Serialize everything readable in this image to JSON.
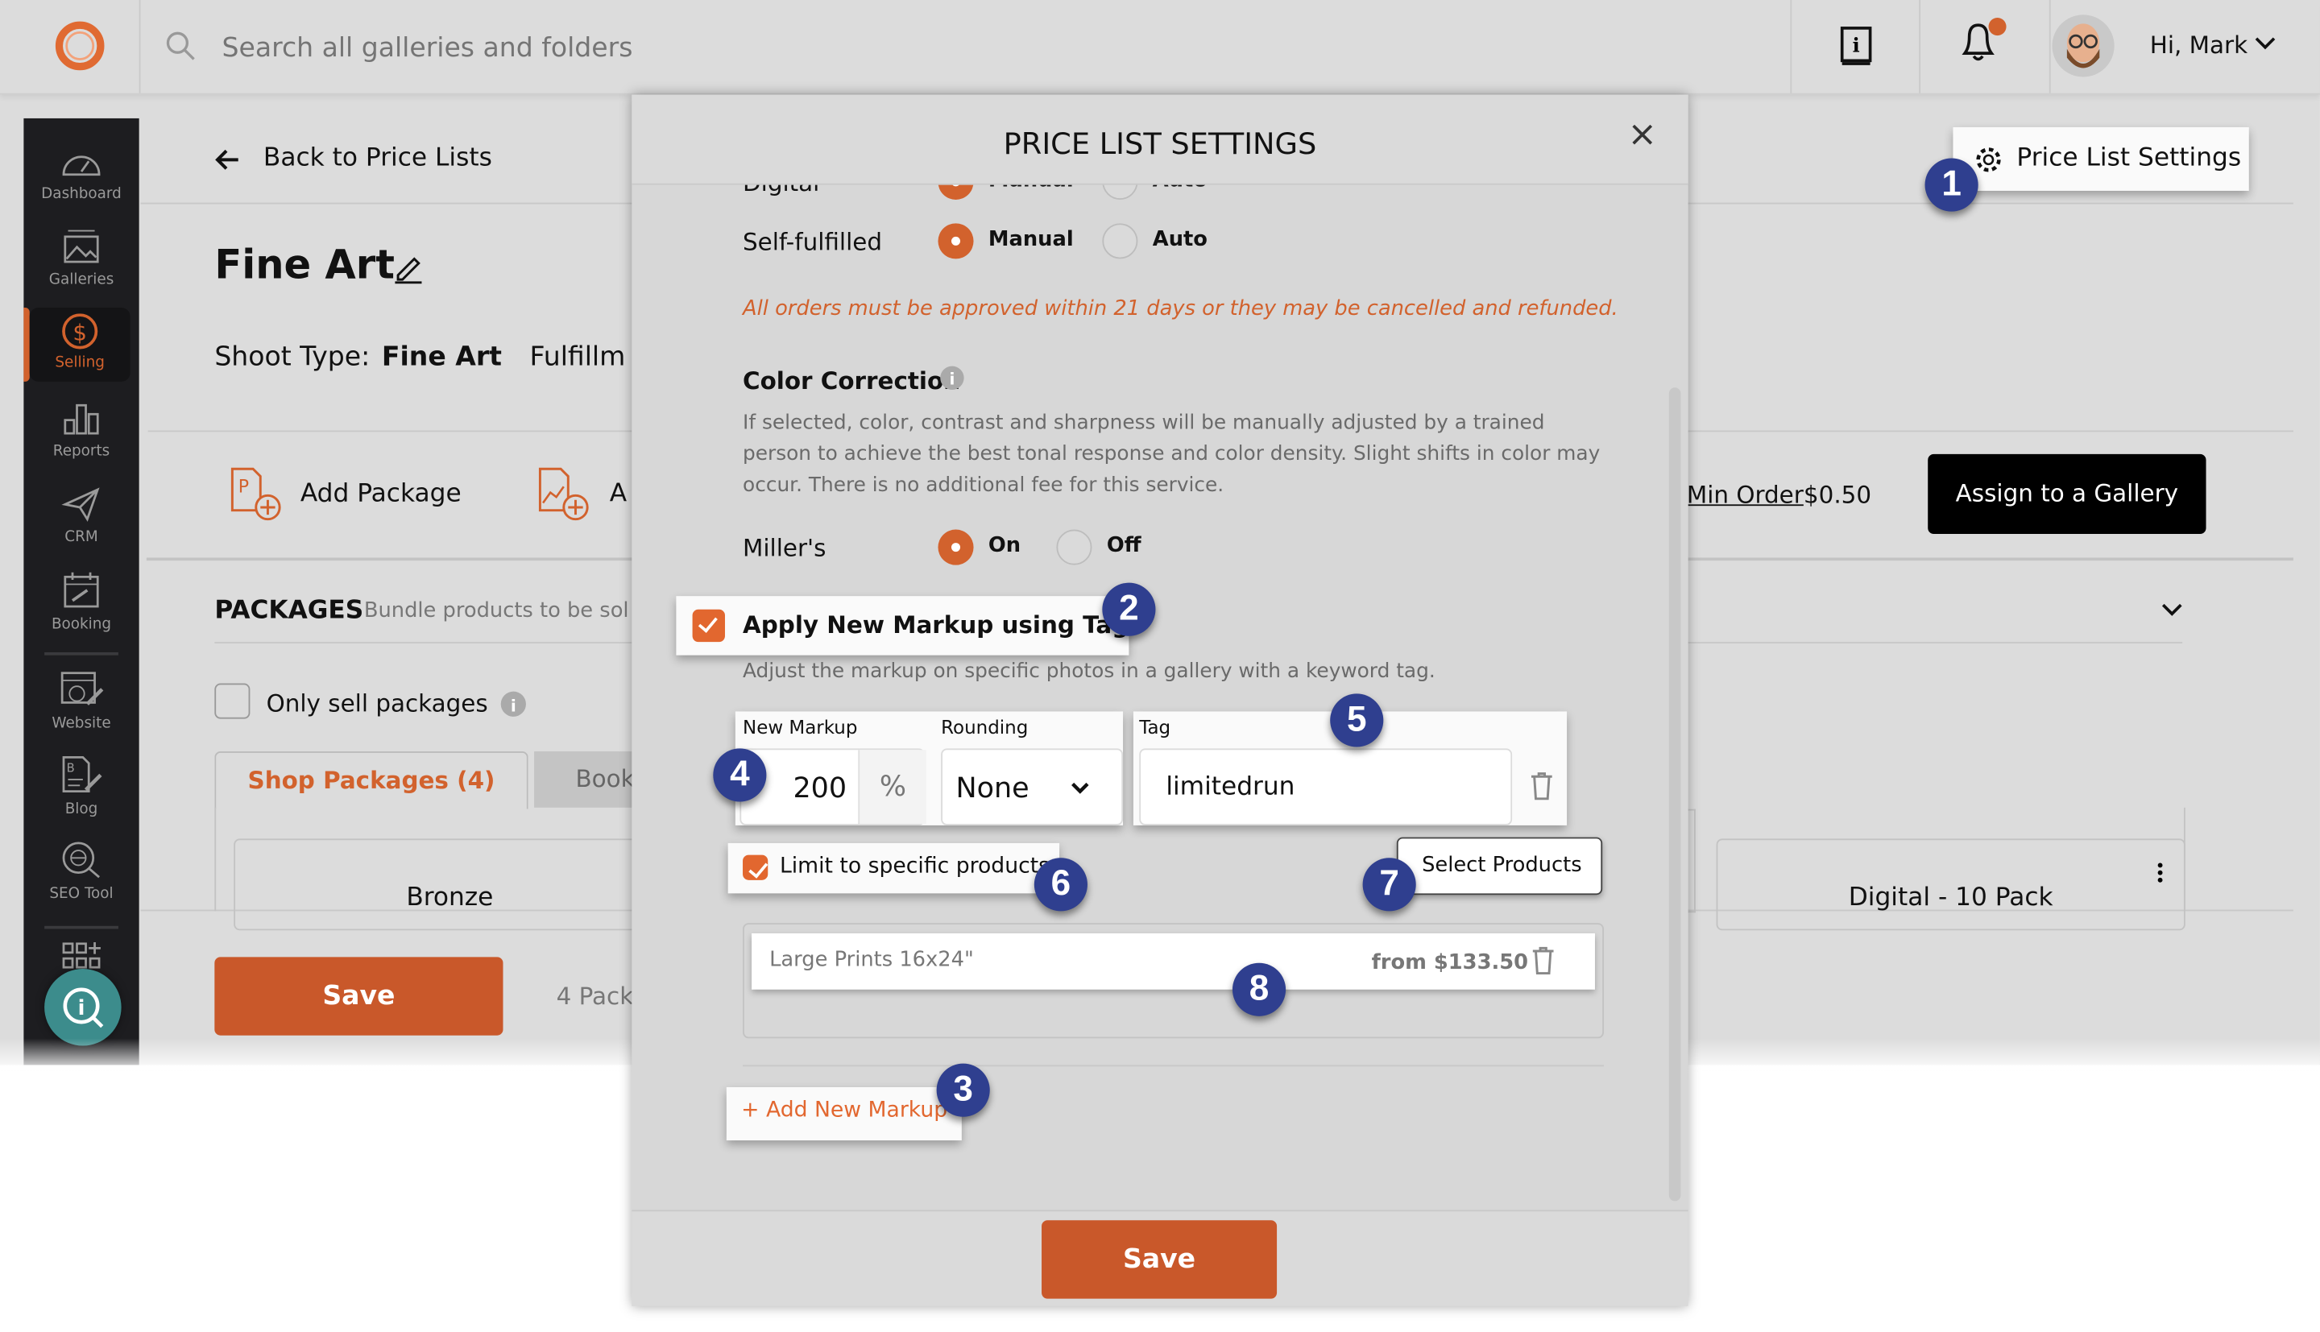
{
  "topbar": {
    "search_placeholder": "Search all galleries and folders",
    "greeting": "Hi, Mark",
    "notification_dot_color": "#d2622d",
    "icons": [
      "logo-icon",
      "search-icon",
      "help-book-icon",
      "bell-icon",
      "avatar",
      "chevron-down-icon"
    ]
  },
  "sidebar": {
    "items": [
      {
        "label": "Dashboard",
        "icon": "dashboard-gauge-icon"
      },
      {
        "label": "Galleries",
        "icon": "galleries-image-icon"
      },
      {
        "label": "Selling",
        "icon": "dollar-icon",
        "active": true
      },
      {
        "label": "Reports",
        "icon": "bar-chart-icon"
      },
      {
        "label": "CRM",
        "icon": "paper-plane-icon"
      },
      {
        "label": "Booking",
        "icon": "calendar-icon"
      },
      {
        "label": "Website",
        "icon": "website-edit-icon"
      },
      {
        "label": "Blog",
        "icon": "blog-edit-icon"
      },
      {
        "label": "SEO Tool",
        "icon": "seo-globe-icon"
      }
    ],
    "apps_icon": "add-apps-icon",
    "help_icon": "help-search-icon"
  },
  "main": {
    "back_label": "Back to Price Lists",
    "title": "Fine Art",
    "shoot_type_label": "Shoot Type:",
    "shoot_type_value": "Fine Art",
    "fulfillment_label": "Fulfillm",
    "add_package_label": "Add Package",
    "add_second_label": "A",
    "min_order_label": "Min Order",
    "min_order_value": "$0.50",
    "assign_button": "Assign to a Gallery",
    "price_list_settings_button": "Price List Settings",
    "packages_heading": "PACKAGES",
    "packages_subtitle": "Bundle products to be sol",
    "only_sell_packages": "Only sell packages",
    "tabs": [
      {
        "label": "Shop Packages (4)",
        "active": true
      },
      {
        "label": "Book"
      }
    ],
    "cards": [
      "Bronze",
      "Digital - 10 Pack"
    ],
    "save_button": "Save",
    "pack_count": "4 Pack",
    "accent_color": "#d2622d"
  },
  "modal": {
    "title": "PRICE LIST SETTINGS",
    "digital_row": {
      "label": "Digital",
      "manual": "Manual",
      "auto": "Auto",
      "selected": "Manual"
    },
    "self_fulfilled_row": {
      "label": "Self-fulfilled",
      "manual": "Manual",
      "auto": "Auto",
      "selected": "Manual"
    },
    "warning": "All orders must be approved within 21 days or they may be cancelled and refunded.",
    "color_correction": {
      "heading": "Color Correction",
      "description_lines": [
        "If selected, color, contrast and sharpness will be manually adjusted by a trained",
        "person to achieve the best tonal response and color density. Slight shifts in color may",
        "occur. There is no additional fee for this service."
      ]
    },
    "millers_row": {
      "label": "Miller's",
      "on": "On",
      "off": "Off",
      "selected": "On"
    },
    "apply_markup": {
      "label": "Apply New Markup using Tags",
      "checked": true
    },
    "apply_markup_help": "Adjust the markup on specific photos in a gallery with a keyword tag.",
    "markup": {
      "new_markup_label": "New Markup",
      "new_markup_value": "200",
      "unit": "%",
      "rounding_label": "Rounding",
      "rounding_value": "None",
      "tag_label": "Tag",
      "tag_value": "limitedrun"
    },
    "limit_products": {
      "label": "Limit to specific products:",
      "checked": true
    },
    "select_products_button": "Select Products",
    "products": [
      {
        "name": "Large Prints 16x24\"",
        "price": "from $133.50"
      }
    ],
    "add_markup_button": "+ Add New Markup",
    "save_button": "Save"
  },
  "callouts": [
    "1",
    "2",
    "3",
    "4",
    "5",
    "6",
    "7",
    "8"
  ],
  "callout_color": "#2f3f8f"
}
